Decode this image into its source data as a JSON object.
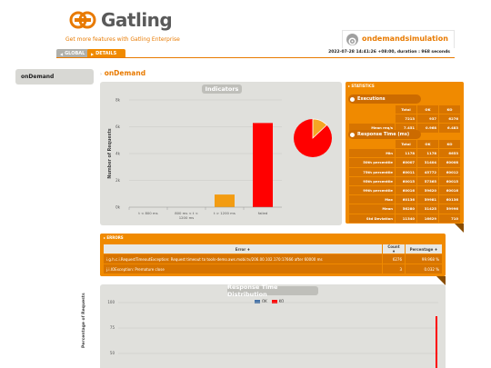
{
  "brand": {
    "name": "Gatling",
    "enterprise_link": "Get more features with Gatling Enterprise",
    "simulation_name": "ondemandsimulation",
    "run_info": "2022-07-28 14:41:26 +08:00, duration : 968 seconds"
  },
  "tabs": {
    "global": "GLOBAL",
    "details": "DETAILS"
  },
  "sidebar": {
    "items": [
      {
        "label": "onDemand"
      }
    ]
  },
  "main": {
    "title": "onDemand"
  },
  "indicators": {
    "title": "Indicators",
    "chart_data": {
      "type": "bar",
      "categories": [
        "t < 800 ms",
        "800 ms < t < 1200 ms",
        "t > 1200 ms",
        "failed"
      ],
      "values": [
        0,
        0,
        942,
        6279
      ],
      "colors": [
        "#4caf50",
        "#f5c000",
        "#f39c12",
        "#ff0000"
      ],
      "ylabel": "Number of Requests",
      "yticks": [
        "0k",
        "2k",
        "4k",
        "6k",
        "8k"
      ],
      "ylim": [
        0,
        8000
      ]
    },
    "pie": {
      "ok_fraction": 0.13,
      "ko_fraction": 0.87,
      "ok_color": "#f5a623",
      "ko_color": "#ff0000"
    }
  },
  "statistics": {
    "title": "STATISTICS",
    "executions_label": "Executions",
    "response_time_label": "Response Time (ms)",
    "columns": [
      "Total",
      "OK",
      "KO"
    ],
    "executions_rows": [
      {
        "label": "",
        "values": [
          "7213",
          "937",
          "6276"
        ]
      },
      {
        "label": "Mean req/s",
        "values": [
          "7.451",
          "0.968",
          "6.483"
        ]
      }
    ],
    "response_rows": [
      {
        "label": "Min",
        "values": [
          "1178",
          "1178",
          "6653"
        ]
      },
      {
        "label": "50th percentile",
        "values": [
          "60007",
          "31404",
          "60008"
        ]
      },
      {
        "label": "75th percentile",
        "values": [
          "60011",
          "45772",
          "60012"
        ]
      },
      {
        "label": "95th percentile",
        "values": [
          "60015",
          "57365",
          "60015"
        ]
      },
      {
        "label": "99th percentile",
        "values": [
          "60016",
          "59620",
          "60016"
        ]
      },
      {
        "label": "Max",
        "values": [
          "60136",
          "59981",
          "60136"
        ]
      },
      {
        "label": "Mean",
        "values": [
          "56280",
          "31425",
          "59996"
        ]
      },
      {
        "label": "Std Deviation",
        "values": [
          "11340",
          "16629",
          "710"
        ]
      }
    ]
  },
  "errors": {
    "title": "ERRORS",
    "columns": [
      "Error ♦",
      "Count ♦",
      "Percentage ♦"
    ],
    "rows": [
      {
        "error": "i.g.h.c.i.RequestTimeoutException: Request timeout to tools-demo.aws.mobi.tv/206.00.102.170:17666 after 60000 ms",
        "count": "6276",
        "percentage": "99.968 %"
      },
      {
        "error": "j.i.IOException: Premature close",
        "count": "3",
        "percentage": "0.032 %"
      }
    ]
  },
  "distribution": {
    "title": "Response Time Distribution",
    "legend": [
      "OK",
      "KO"
    ],
    "ylabel": "Percentage of Requests",
    "yticks": [
      "100",
      "75",
      "50"
    ],
    "colors": {
      "ok": "#4572a7",
      "ko": "#ff0000"
    }
  }
}
